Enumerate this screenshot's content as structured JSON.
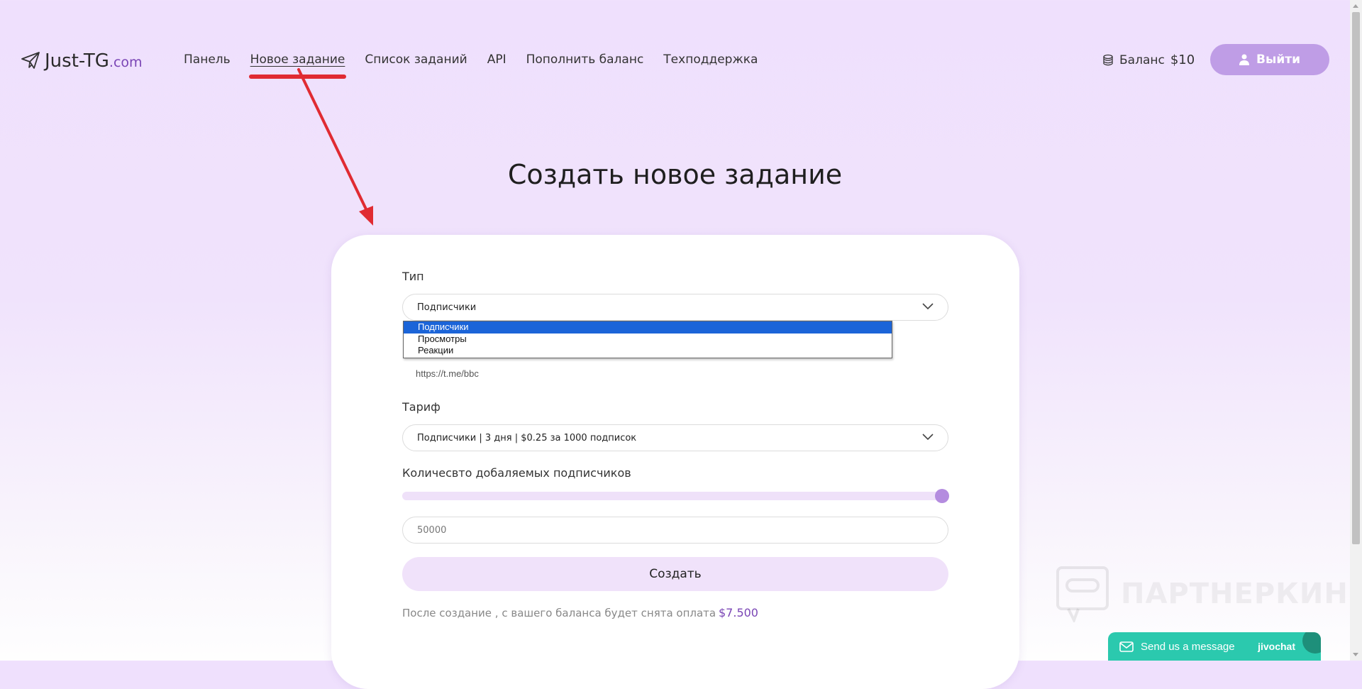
{
  "brand": {
    "name": "Just-TG",
    "domain": ".com"
  },
  "nav": [
    {
      "label": "Панель"
    },
    {
      "label": "Новое задание",
      "active": true
    },
    {
      "label": "Список заданий"
    },
    {
      "label": "API"
    },
    {
      "label": "Пополнить баланс"
    },
    {
      "label": "Техподдержка"
    }
  ],
  "balance": {
    "label": "Баланс",
    "amount": "$10"
  },
  "logout_label": "Выйти",
  "page_title": "Создать новое задание",
  "form": {
    "type_label": "Тип",
    "type_value": "Подписчики",
    "type_options": [
      "Подписчики",
      "Просмотры",
      "Реакции"
    ],
    "link_value": "https://t.me/bbc",
    "tariff_label": "Тариф",
    "tariff_value": "Подписчики | 3 дня | $0.25 за 1000 подписок",
    "quantity_label": "Количесвто добаляемых подписчиков",
    "quantity_value": "50000",
    "slider_level": 1.0,
    "create_label": "Создать",
    "cost_note": "После создание , с вашего баланса будет снята оплата",
    "cost_value": "$7.500"
  },
  "watermark": "ПАРТНЕРКИН",
  "chat": {
    "message": "Send us a message",
    "brand": "jivochat"
  },
  "colors": {
    "accent": "#bf9de6",
    "price": "#7a45b5",
    "annotation": "#e02b32",
    "chat": "#2bc9ae"
  }
}
